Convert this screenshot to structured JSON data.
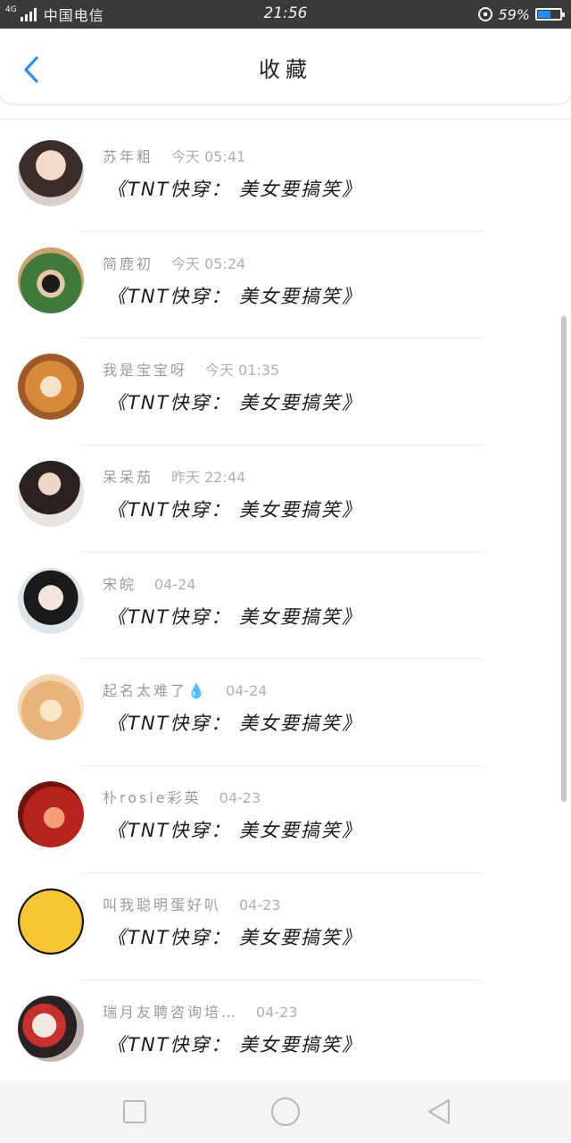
{
  "status_bar": {
    "network": "4G",
    "carrier": "中国电信",
    "time": "21:56",
    "battery_percent": "59%",
    "battery_level": 0.59,
    "battery_color": "#1e90ff",
    "icons": [
      "signal-icon",
      "rotation-lock-icon",
      "battery-icon"
    ]
  },
  "header": {
    "title": "收藏",
    "back_icon": "chevron-left-icon",
    "accent_color": "#2e8ff0"
  },
  "favorites": [
    {
      "name": "苏年粗",
      "time": "今天 05:41",
      "title": "《TNT快穿： 美女要搞笑》",
      "avatar": "avatar-photo-girl"
    },
    {
      "name": "简鹿初",
      "time": "今天 05:24",
      "title": "《TNT快穿： 美女要搞笑》",
      "avatar": "avatar-photo-outdoor"
    },
    {
      "name": "我是宝宝呀",
      "time": "今天 01:35",
      "title": "《TNT快穿： 美女要搞笑》",
      "avatar": "avatar-shiba-dog"
    },
    {
      "name": "呆呆茄",
      "time": "昨天 22:44",
      "title": "《TNT快穿： 美女要搞笑》",
      "avatar": "avatar-photo-girl-dark"
    },
    {
      "name": "宋皖",
      "time": "04-24",
      "title": "《TNT快穿： 美女要搞笑》",
      "avatar": "avatar-photo-face"
    },
    {
      "name": "起名太难了💧",
      "time": "04-24",
      "title": "《TNT快穿： 美女要搞笑》",
      "avatar": "avatar-cartoon-bear"
    },
    {
      "name": "朴rosie彩英",
      "time": "04-23",
      "title": "《TNT快穿： 美女要搞笑》",
      "avatar": "avatar-photo-red"
    },
    {
      "name": "叫我聪明蛋好叭",
      "time": "04-23",
      "title": "《TNT快穿： 美女要搞笑》",
      "avatar": "avatar-crying-emoji"
    },
    {
      "name": "瑞月友聘咨询培…",
      "time": "04-23",
      "title": "《TNT快穿： 美女要搞笑》",
      "avatar": "avatar-photo-girl-cat"
    }
  ],
  "nav_bar": {
    "buttons": [
      "recent-apps-icon",
      "home-icon",
      "back-icon"
    ]
  }
}
